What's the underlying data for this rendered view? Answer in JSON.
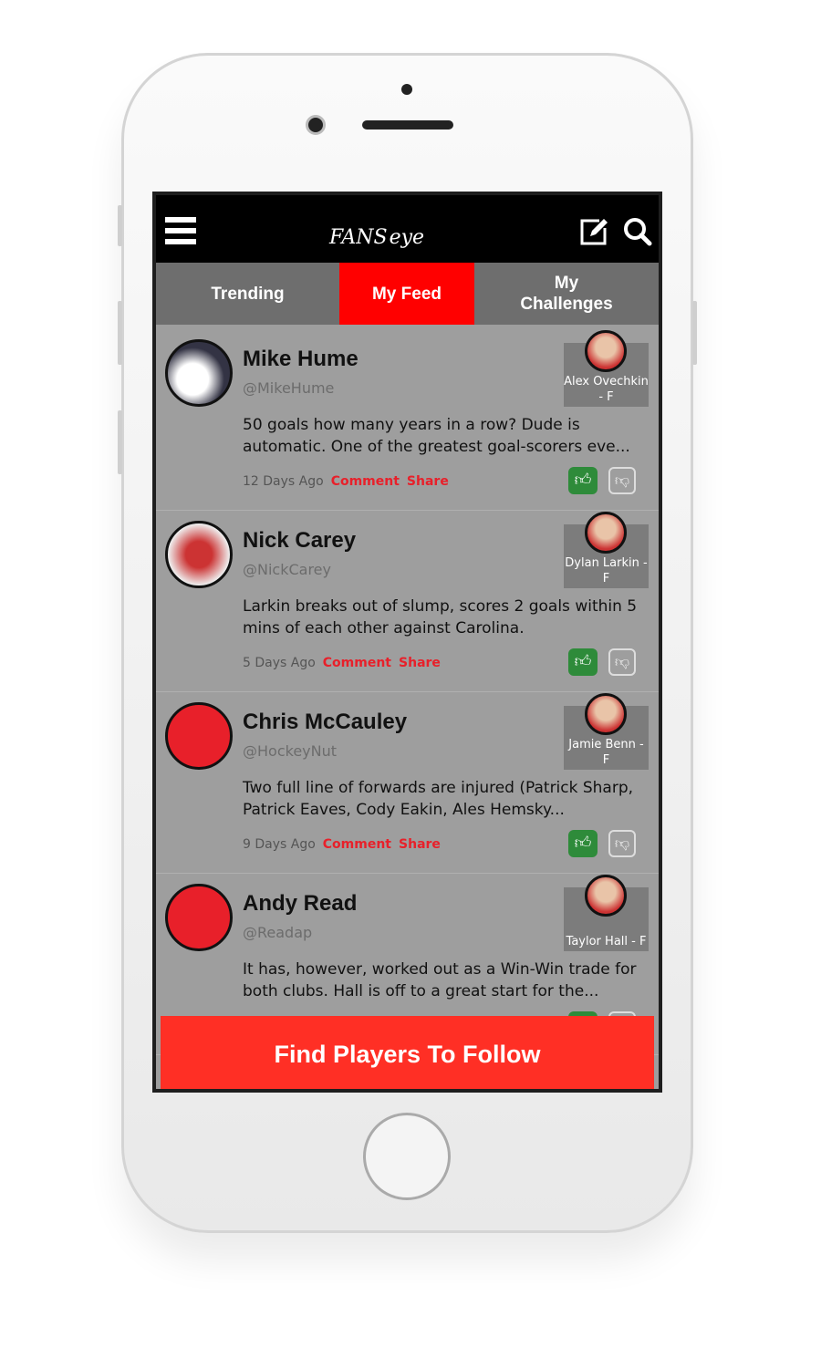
{
  "header": {
    "logo_main": "FANS",
    "logo_sub": "eye",
    "menu_icon": "hamburger-icon",
    "compose_icon": "edit-icon",
    "search_icon": "search-icon"
  },
  "tabs": [
    {
      "label": "Trending"
    },
    {
      "label": "My Feed",
      "active": true
    },
    {
      "label": "My Challenges"
    }
  ],
  "posts": [
    {
      "name": "Mike Hume",
      "handle": "@MikeHume",
      "text": "50 goals how many years in a row? Dude is automatic. One of the greatest goal-scorers eve...",
      "time": "12 Days Ago",
      "player": "Alex Ovechkin - F"
    },
    {
      "name": "Nick Carey",
      "handle": "@NickCarey",
      "text": "Larkin breaks out of slump, scores 2 goals within 5 mins of each other against Carolina.",
      "time": "5 Days Ago",
      "player": "Dylan Larkin - F"
    },
    {
      "name": "Chris McCauley",
      "handle": "@HockeyNut",
      "text": "Two full line of forwards are injured (Patrick Sharp, Patrick Eaves, Cody Eakin, Ales Hemsky...",
      "time": "9 Days Ago",
      "player": "Jamie Benn - F"
    },
    {
      "name": "Andy Read",
      "handle": "@Readap",
      "text": "It has, however, worked out as a Win-Win trade for both clubs. Hall is off to a great start for the...",
      "time": "",
      "player": "Taylor Hall - F"
    }
  ],
  "actions": {
    "comment": "Comment",
    "share": "Share",
    "like_icon": "thumbs-up-icon",
    "dislike_icon": "thumbs-down-icon"
  },
  "cta": "Find Players To Follow",
  "colors": {
    "accent": "#ff0000",
    "cta": "#ff2f25",
    "like": "#2e8b3a"
  }
}
